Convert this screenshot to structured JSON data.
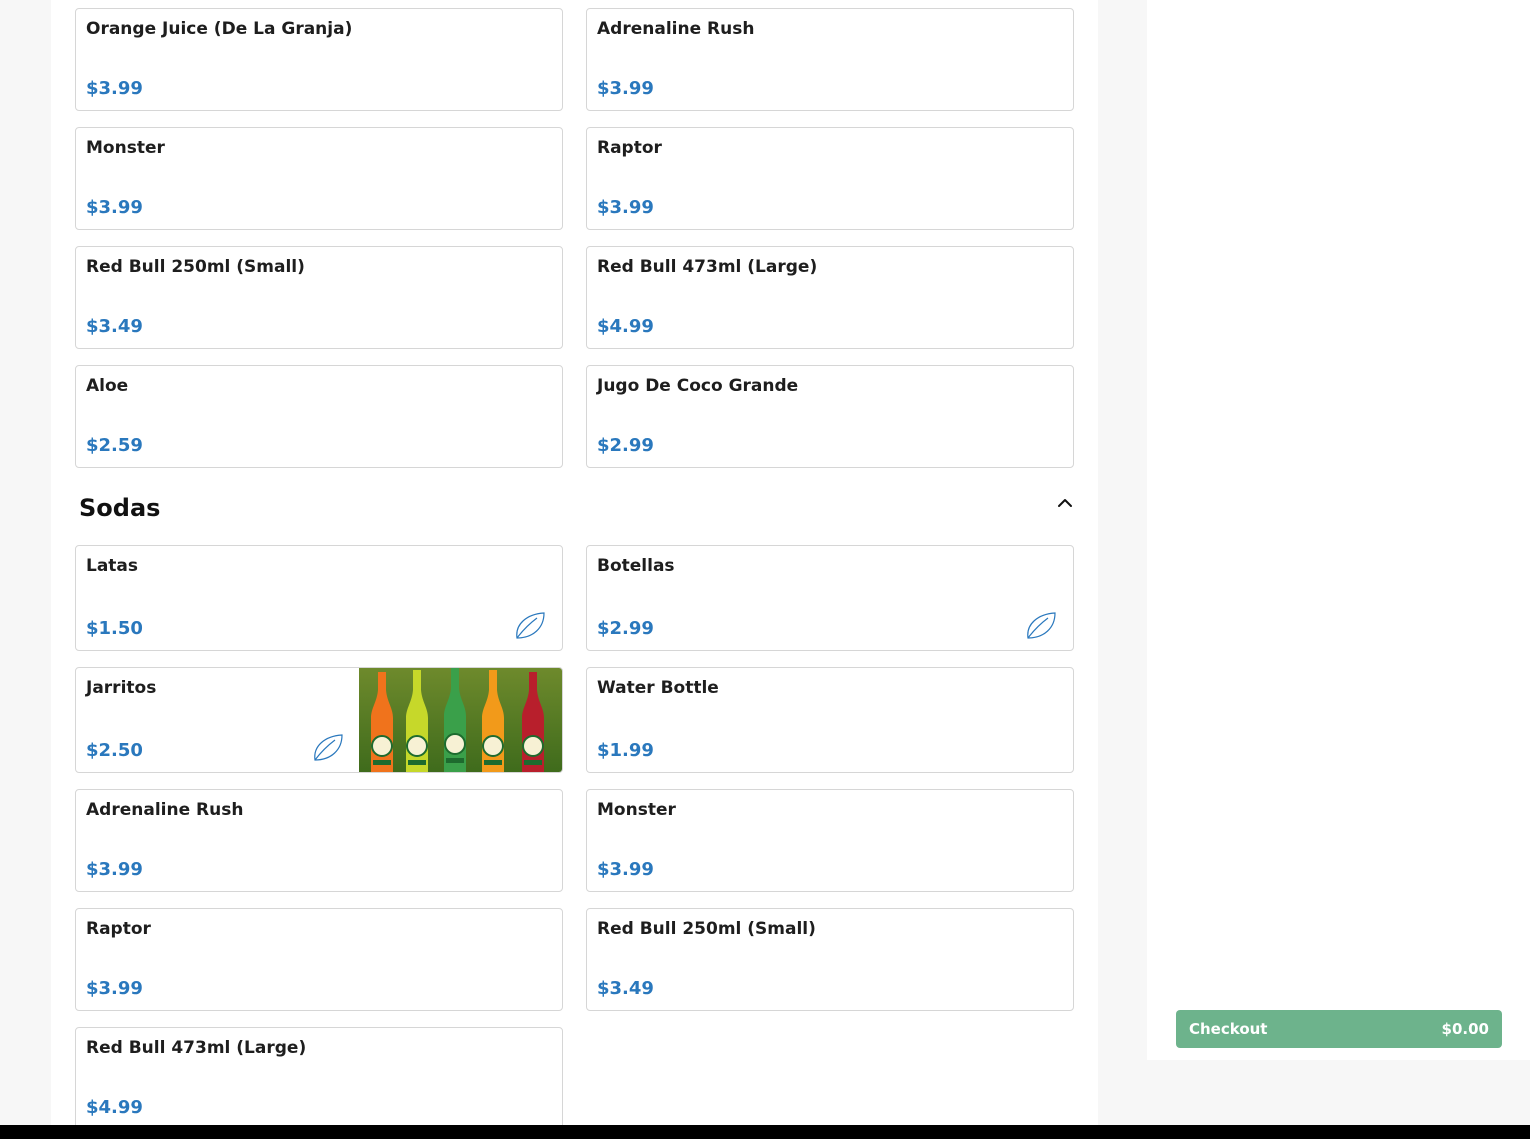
{
  "colors": {
    "price": "#2a78bd",
    "checkout_bg": "#6db38c",
    "border": "#d6d6d6"
  },
  "top_items": [
    {
      "name": "Orange Juice (De La Granja)",
      "price": "$3.99"
    },
    {
      "name": "Adrenaline Rush",
      "price": "$3.99"
    },
    {
      "name": "Monster",
      "price": "$3.99"
    },
    {
      "name": "Raptor",
      "price": "$3.99"
    },
    {
      "name": "Red Bull 250ml (Small)",
      "price": "$3.49"
    },
    {
      "name": "Red Bull 473ml (Large)",
      "price": "$4.99"
    },
    {
      "name": "Aloe",
      "price": "$2.59"
    },
    {
      "name": "Jugo De Coco Grande",
      "price": "$2.99"
    }
  ],
  "sodas": {
    "title": "Sodas",
    "toggle_icon": "chevron-up-icon",
    "items": [
      {
        "name": "Latas",
        "price": "$1.50",
        "icon": "leaf-icon"
      },
      {
        "name": "Botellas",
        "price": "$2.99",
        "icon": "leaf-icon"
      },
      {
        "name": "Jarritos",
        "price": "$2.50",
        "icon": "leaf-icon",
        "image": "jarritos-bottles-photo"
      },
      {
        "name": "Water Bottle",
        "price": "$1.99"
      },
      {
        "name": "Adrenaline Rush",
        "price": "$3.99"
      },
      {
        "name": "Monster",
        "price": "$3.99"
      },
      {
        "name": "Raptor",
        "price": "$3.99"
      },
      {
        "name": "Red Bull 250ml (Small)",
        "price": "$3.49"
      },
      {
        "name": "Red Bull 473ml (Large)",
        "price": "$4.99"
      }
    ]
  },
  "checkout": {
    "label": "Checkout",
    "total": "$0.00"
  }
}
